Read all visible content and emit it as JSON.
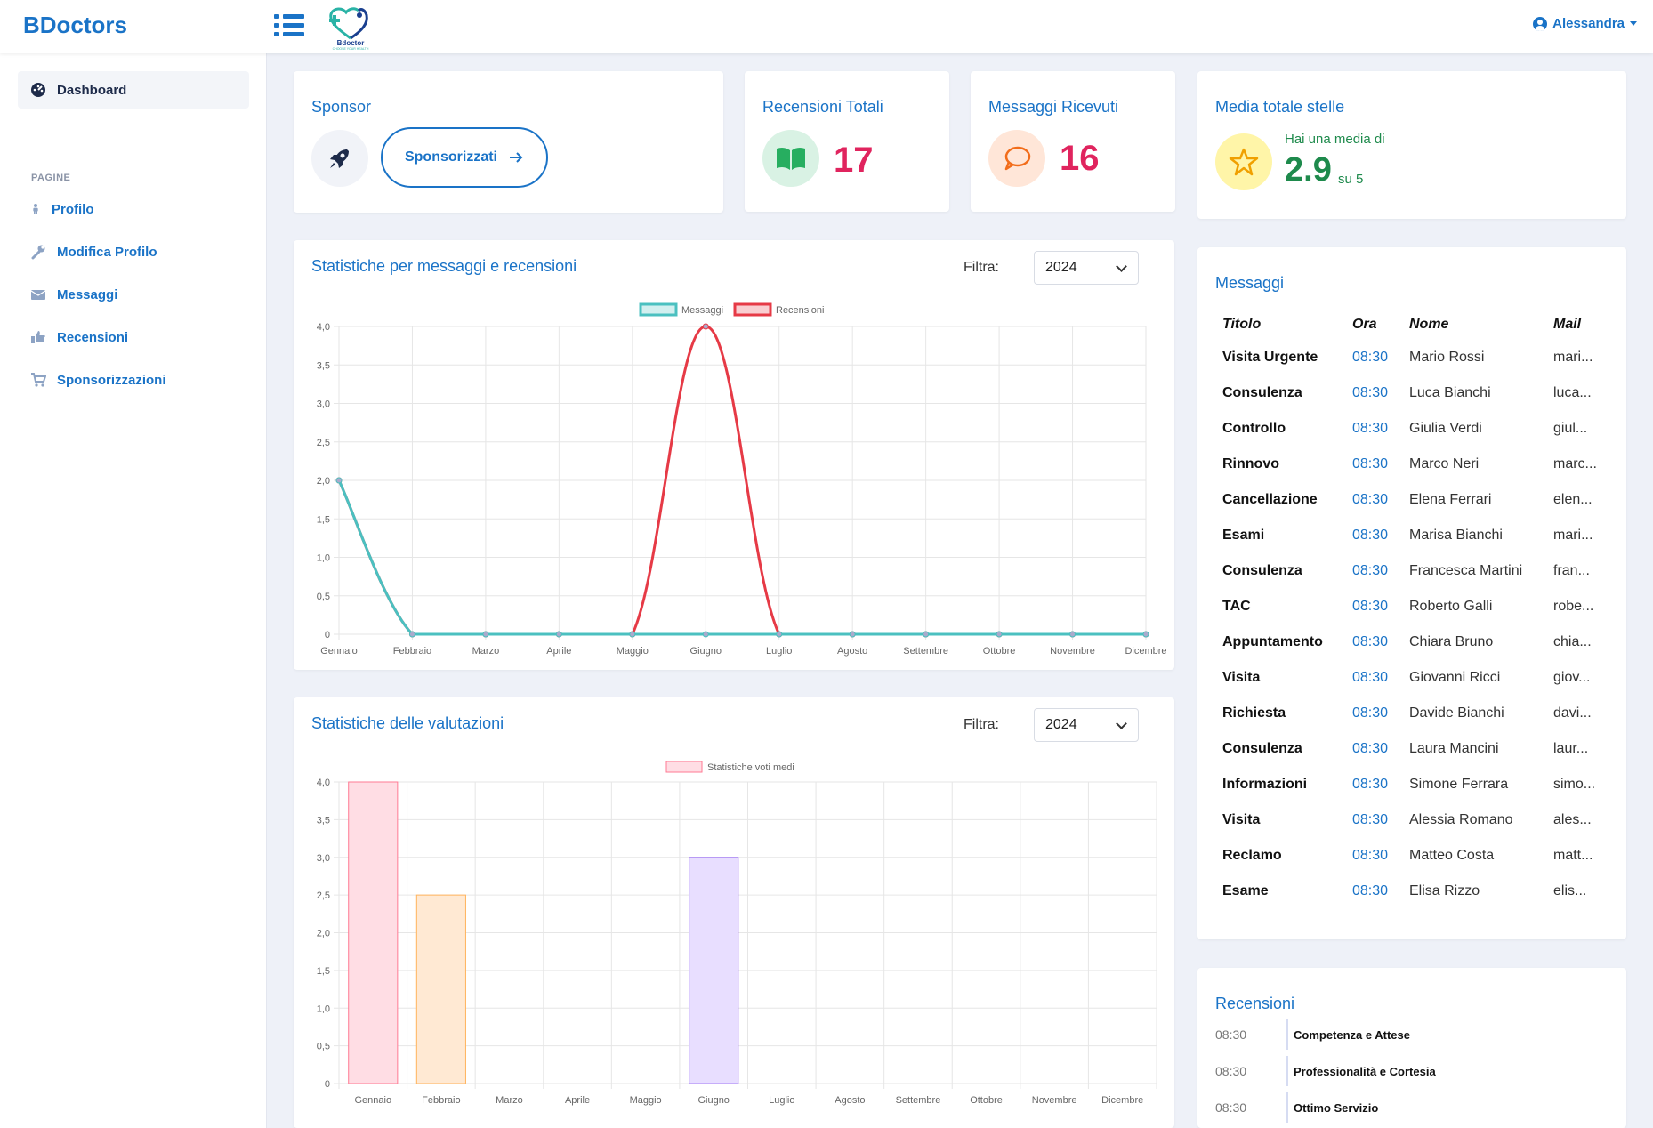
{
  "app": {
    "brand": "BDoctors",
    "logo_text": "Bdoctor",
    "logo_tagline": "CHOOSE YOUR HEALTH",
    "user": "Alessandra"
  },
  "sidebar": {
    "dashboard": "Dashboard",
    "section": "PAGINE",
    "items": [
      {
        "label": "Profilo",
        "icon": "person-icon"
      },
      {
        "label": "Modifica Profilo",
        "icon": "wrench-icon"
      },
      {
        "label": "Messaggi",
        "icon": "envelope-icon"
      },
      {
        "label": "Recensioni",
        "icon": "thumbs-up-icon"
      },
      {
        "label": "Sponsorizzazioni",
        "icon": "cart-icon"
      }
    ]
  },
  "cards": {
    "sponsor": {
      "title": "Sponsor",
      "button": "Sponsorizzati"
    },
    "reviews": {
      "title": "Recensioni Totali",
      "value": "17"
    },
    "messages": {
      "title": "Messaggi Ricevuti",
      "value": "16"
    },
    "stars": {
      "title": "Media totale stelle",
      "caption": "Hai una media di",
      "value": "2.9",
      "suffix": "su 5"
    }
  },
  "filter": {
    "label": "Filtra:",
    "year": "2024"
  },
  "charts": {
    "line_title": "Statistiche per messaggi e recensioni",
    "bar_title": "Statistiche delle valutazioni"
  },
  "chart_data": [
    {
      "type": "line",
      "categories": [
        "Gennaio",
        "Febbraio",
        "Marzo",
        "Aprile",
        "Maggio",
        "Giugno",
        "Luglio",
        "Agosto",
        "Settembre",
        "Ottobre",
        "Novembre",
        "Dicembre"
      ],
      "series": [
        {
          "name": "Messaggi",
          "color": "#4bc0c0",
          "values": [
            2,
            0,
            0,
            0,
            0,
            0,
            0,
            0,
            0,
            0,
            0,
            0
          ]
        },
        {
          "name": "Recensioni",
          "color": "#e63a46",
          "values": [
            2,
            0,
            0,
            0,
            0,
            4,
            0,
            0,
            0,
            0,
            0,
            0
          ]
        }
      ],
      "yticks": [
        "0",
        "0,5",
        "1,0",
        "1,5",
        "2,0",
        "2,5",
        "3,0",
        "3,5",
        "4,0"
      ],
      "ylim": [
        0,
        4
      ],
      "legend": "top",
      "grid": true
    },
    {
      "type": "bar",
      "categories": [
        "Gennaio",
        "Febbraio",
        "Marzo",
        "Aprile",
        "Maggio",
        "Giugno",
        "Luglio",
        "Agosto",
        "Settembre",
        "Ottobre",
        "Novembre",
        "Dicembre"
      ],
      "series": [
        {
          "name": "Statistiche voti medi",
          "values": [
            4,
            2.5,
            0,
            0,
            0,
            3,
            0,
            0,
            0,
            0,
            0,
            0
          ]
        }
      ],
      "bar_colors": [
        "#ffdde4",
        "#ffe9d3",
        "#fff",
        "#fff",
        "#fff",
        "#e8deff",
        "#fff",
        "#fff",
        "#fff",
        "#fff",
        "#fff",
        "#fff"
      ],
      "bar_borders": [
        "#ff7a93",
        "#ffb35c",
        "#fff",
        "#fff",
        "#fff",
        "#a47cf5",
        "#fff",
        "#fff",
        "#fff",
        "#fff",
        "#fff",
        "#fff"
      ],
      "yticks": [
        "0",
        "0,5",
        "1,0",
        "1,5",
        "2,0",
        "2,5",
        "3,0",
        "3,5",
        "4,0"
      ],
      "ylim": [
        0,
        4
      ],
      "legend": "top",
      "grid": true
    }
  ],
  "messages": {
    "title": "Messaggi",
    "headers": [
      "Titolo",
      "Ora",
      "Nome",
      "Mail"
    ],
    "rows": [
      [
        "Visita Urgente",
        "08:30",
        "Mario Rossi",
        "mari..."
      ],
      [
        "Consulenza",
        "08:30",
        "Luca Bianchi",
        "luca..."
      ],
      [
        "Controllo",
        "08:30",
        "Giulia Verdi",
        "giul..."
      ],
      [
        "Rinnovo",
        "08:30",
        "Marco Neri",
        "marc..."
      ],
      [
        "Cancellazione",
        "08:30",
        "Elena Ferrari",
        "elen..."
      ],
      [
        "Esami",
        "08:30",
        "Marisa Bianchi",
        "mari..."
      ],
      [
        "Consulenza",
        "08:30",
        "Francesca Martini",
        "fran..."
      ],
      [
        "TAC",
        "08:30",
        "Roberto Galli",
        "robe..."
      ],
      [
        "Appuntamento",
        "08:30",
        "Chiara Bruno",
        "chia..."
      ],
      [
        "Visita",
        "08:30",
        "Giovanni Ricci",
        "giov..."
      ],
      [
        "Richiesta",
        "08:30",
        "Davide Bianchi",
        "davi..."
      ],
      [
        "Consulenza",
        "08:30",
        "Laura Mancini",
        "laur..."
      ],
      [
        "Informazioni",
        "08:30",
        "Simone Ferrara",
        "simo..."
      ],
      [
        "Visita",
        "08:30",
        "Alessia Romano",
        "ales..."
      ],
      [
        "Reclamo",
        "08:30",
        "Matteo Costa",
        "matt..."
      ],
      [
        "Esame",
        "08:30",
        "Elisa Rizzo",
        "elis..."
      ]
    ]
  },
  "reviews": {
    "title": "Recensioni",
    "items": [
      {
        "time": "08:30",
        "subject": "Competenza e Attese"
      },
      {
        "time": "08:30",
        "subject": "Professionalità e Cortesia"
      },
      {
        "time": "08:30",
        "subject": "Ottimo Servizio"
      }
    ]
  }
}
